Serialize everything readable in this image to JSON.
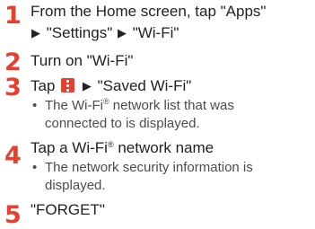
{
  "steps": [
    {
      "number": "1",
      "line1": "From the Home screen, tap \"Apps\"",
      "line2_part1": "\"Settings\"",
      "line2_part2": "\"Wi-Fi\""
    },
    {
      "number": "2",
      "text": "Turn on \"Wi-Fi\""
    },
    {
      "number": "3",
      "text_before_icon": "Tap",
      "text_after_icon": "\"Saved Wi-Fi\"",
      "icon": "more-options-icon",
      "note_line1_a": "The Wi-Fi",
      "note_reg": "®",
      "note_line1_b": " network list that was",
      "note_line2": "connected to is displayed."
    },
    {
      "number": "4",
      "text_a": "Tap a Wi-Fi",
      "text_reg": "®",
      "text_b": " network name",
      "note_line1": "The network security information is",
      "note_line2": "displayed."
    },
    {
      "number": "5",
      "text": "\"FORGET\""
    }
  ],
  "glyphs": {
    "arrow": "▶",
    "bullet": "•"
  },
  "colors": {
    "step_number": "#e5402e",
    "icon_background": "#e5402e",
    "text": "#222222",
    "note_text": "#4b4b4b"
  }
}
